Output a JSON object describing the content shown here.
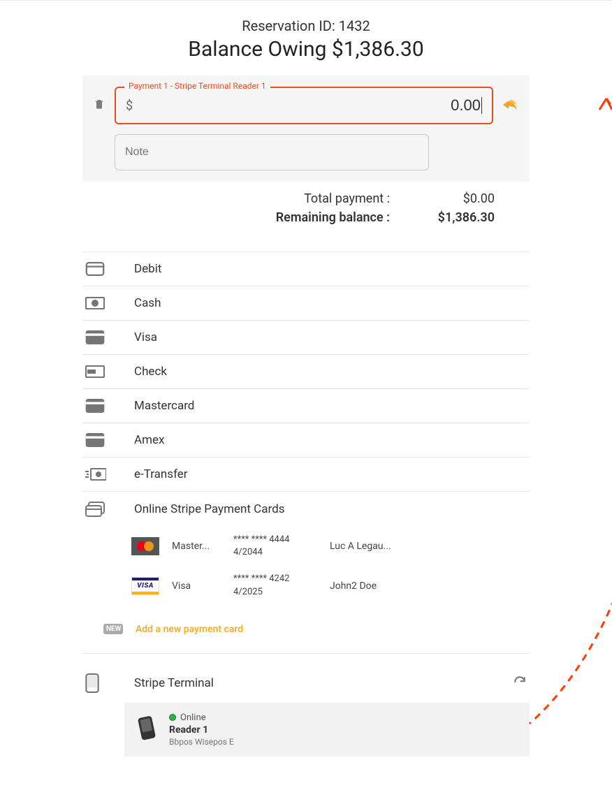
{
  "header": {
    "reservation_prefix": "Reservation ID: ",
    "reservation_id": "1432",
    "balance_prefix": "Balance Owing ",
    "balance_amount": "$1,386.30"
  },
  "payment_input": {
    "fieldset_label": "Payment 1 - Stripe Terminal Reader 1",
    "currency": "$",
    "amount_value": "0.00",
    "note_placeholder": "Note"
  },
  "totals": {
    "total_label": "Total payment :",
    "total_value": "$0.00",
    "remaining_label": "Remaining balance :",
    "remaining_value": "$1,386.30"
  },
  "methods": [
    {
      "icon": "card-outline",
      "label": "Debit"
    },
    {
      "icon": "cash",
      "label": "Cash"
    },
    {
      "icon": "card-solid",
      "label": "Visa"
    },
    {
      "icon": "check-paper",
      "label": "Check"
    },
    {
      "icon": "card-solid",
      "label": "Mastercard"
    },
    {
      "icon": "card-solid",
      "label": "Amex"
    },
    {
      "icon": "etransfer",
      "label": "e-Transfer"
    }
  ],
  "online_section": {
    "label": "Online Stripe Payment Cards",
    "cards": [
      {
        "brand": "mastercard",
        "brand_label": "Master...",
        "number": "**** **** 4444",
        "exp": "4/2044",
        "name": "Luc A Legau..."
      },
      {
        "brand": "visa",
        "brand_label": "Visa",
        "number": "**** **** 4242",
        "exp": "4/2025",
        "name": "John2 Doe"
      }
    ],
    "new_badge": "NEW",
    "add_card_label": "Add a new payment card"
  },
  "terminal_section": {
    "label": "Stripe Terminal",
    "reader": {
      "status": "Online",
      "name": "Reader 1",
      "model": "Bbpos Wisepos E"
    }
  }
}
